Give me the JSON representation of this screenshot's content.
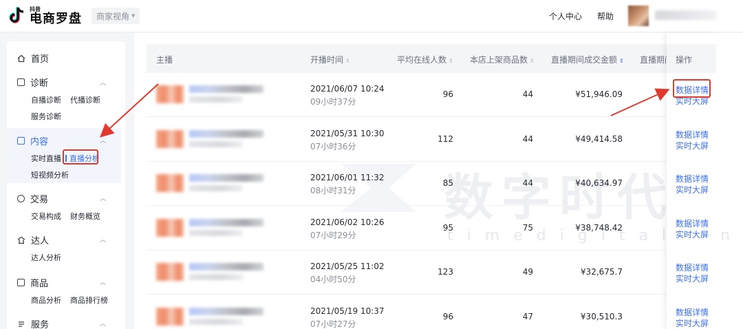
{
  "header": {
    "logo_small": "抖音",
    "logo_big": "电商罗盘",
    "view_select": "商家视角",
    "personal_center": "个人中心",
    "help": "帮助"
  },
  "sidebar": {
    "home": "首页",
    "diagnosis": {
      "title": "诊断",
      "items": [
        "自播诊断",
        "代播诊断",
        "服务诊断"
      ]
    },
    "content": {
      "title": "内容",
      "items": [
        "实时直播",
        "直播分析",
        "短视频分析"
      ]
    },
    "trade": {
      "title": "交易",
      "items": [
        "交易构成",
        "财务概览"
      ]
    },
    "talent": {
      "title": "达人",
      "items": [
        "达人分析"
      ]
    },
    "goods": {
      "title": "商品",
      "items": [
        "商品分析",
        "商品排行榜"
      ]
    },
    "service": {
      "title": "服务"
    }
  },
  "table": {
    "headers": {
      "anchor": "主播",
      "start_time": "开播时间",
      "avg_online": "平均在线人数",
      "shelf_goods": "本店上架商品数",
      "gmv": "直播期间成交金额",
      "truncated": "直播期间",
      "action": "操作"
    },
    "rows": [
      {
        "start": "2021/06/07 10:24",
        "duration": "09小时37分",
        "avg_online": "96",
        "goods": "44",
        "gmv": "¥51,946.09"
      },
      {
        "start": "2021/05/31 10:30",
        "duration": "07小时36分",
        "avg_online": "112",
        "goods": "44",
        "gmv": "¥49,414.58"
      },
      {
        "start": "2021/06/01 11:32",
        "duration": "08小时31分",
        "avg_online": "85",
        "goods": "44",
        "gmv": "¥40,634.97"
      },
      {
        "start": "2021/06/02 10:26",
        "duration": "07小时29分",
        "avg_online": "95",
        "goods": "75",
        "gmv": "¥38,748.42"
      },
      {
        "start": "2021/05/25 11:02",
        "duration": "04小时50分",
        "avg_online": "123",
        "goods": "49",
        "gmv": "¥32,675.7"
      },
      {
        "start": "2021/05/19 10:37",
        "duration": "07小时27分",
        "avg_online": "96",
        "goods": "47",
        "gmv": "¥30,510.3"
      }
    ],
    "action_detail": "数据详情",
    "action_screen": "实时大屏"
  },
  "watermark": {
    "main": "数字时代",
    "sub": "timedigital.cn"
  },
  "colors": {
    "accent": "#3a6ff7",
    "highlight": "#e03a2f"
  }
}
